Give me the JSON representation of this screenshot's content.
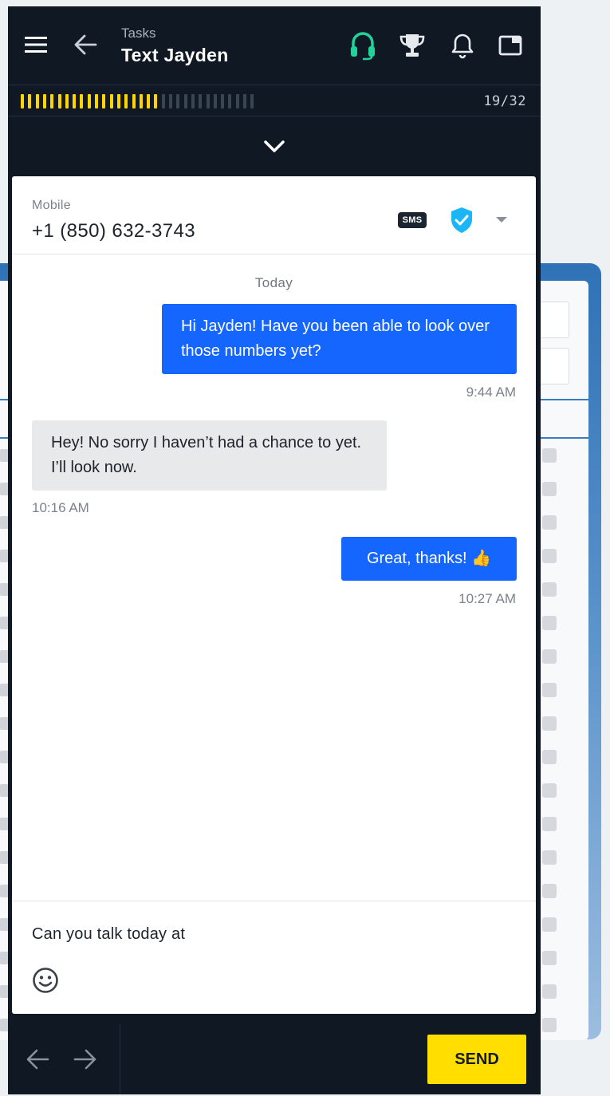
{
  "header": {
    "subtitle": "Tasks",
    "title": "Text Jayden"
  },
  "progress": {
    "count": "19/32",
    "done": 19,
    "total": 32,
    "done_color": "#ffd400",
    "todo_color": "#3a4552"
  },
  "contact": {
    "label": "Mobile",
    "phone": "+1 (850) 632-3743",
    "badge": "SMS",
    "verified_icon": "shield-check-icon",
    "verified_color": "#1ab6f5"
  },
  "conversation": {
    "date": "Today",
    "messages": [
      {
        "direction": "outgoing",
        "text": "Hi Jayden! Have you been able to look over those numbers yet?",
        "time": "9:44 AM"
      },
      {
        "direction": "incoming",
        "text": "Hey! No sorry I haven’t had a chance to yet. I’ll look now.",
        "time": "10:16 AM"
      },
      {
        "direction": "outgoing",
        "text": "Great, thanks! 👍",
        "time": "10:27 AM"
      }
    ]
  },
  "composer": {
    "value": "Can you talk today at"
  },
  "footer": {
    "send_label": "SEND"
  },
  "colors": {
    "panel_bg": "#0f1823",
    "outgoing_bubble": "#1565ff",
    "incoming_bubble": "#e8e9eb",
    "send_button": "#ffde00",
    "headset_active": "#1fd39a"
  }
}
